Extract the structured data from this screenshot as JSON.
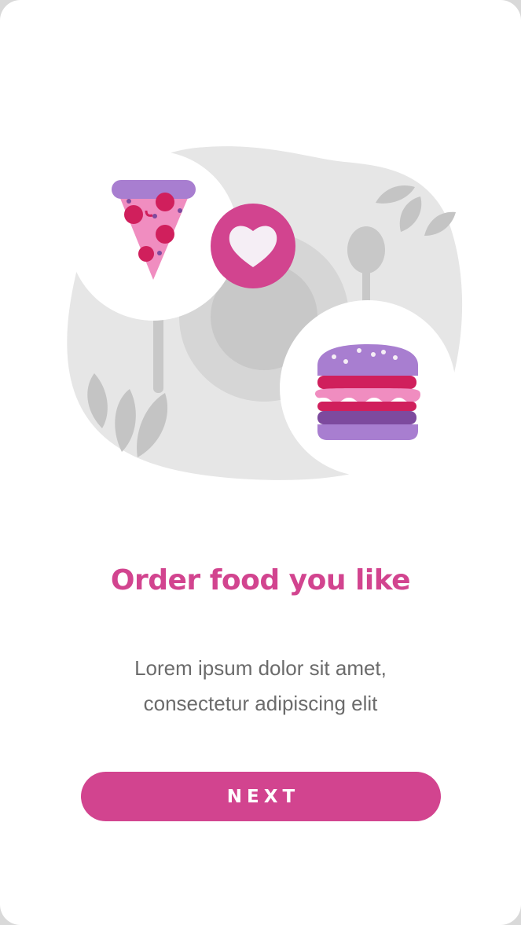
{
  "onboarding": {
    "title": "Order food you like",
    "subtitle": "Lorem ipsum dolor sit amet, consectetur adipiscing elit",
    "next_label": "NEXT"
  },
  "colors": {
    "accent": "#d2448f",
    "accent_light": "#f08dc0",
    "purple": "#a87ed0",
    "dark_purple": "#7d4a9e",
    "pink_red": "#d01f5c",
    "background": "#ffffff",
    "illustration_gray": "#e6e6e6",
    "text_gray": "#6b6b6b"
  },
  "icons": [
    "pizza-slice-icon",
    "heart-icon",
    "burger-icon",
    "spoon-icon",
    "fork-icon",
    "leaf-icon"
  ]
}
